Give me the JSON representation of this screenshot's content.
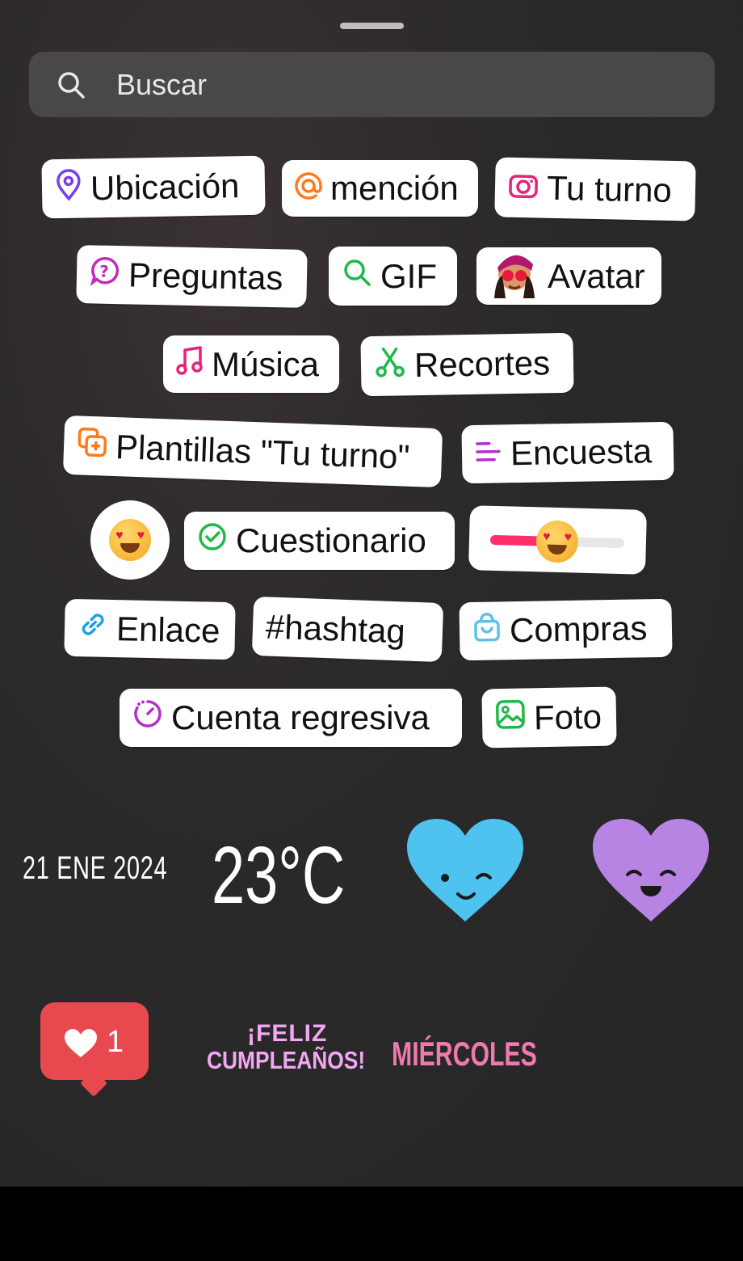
{
  "search": {
    "placeholder": "Buscar"
  },
  "stickers": {
    "ubicacion": "Ubicación",
    "mencion": "mención",
    "tu_turno": "Tu turno",
    "preguntas": "Preguntas",
    "gif": "GIF",
    "avatar": "Avatar",
    "musica": "Música",
    "recortes": "Recortes",
    "plantillas": "Plantillas \"Tu turno\"",
    "encuesta": "Encuesta",
    "cuestionario": "Cuestionario",
    "enlace": "Enlace",
    "hashtag": "#hashtag",
    "compras": "Compras",
    "cuenta_regresiva": "Cuenta regresiva",
    "foto": "Foto"
  },
  "widgets": {
    "date": "21 ENE 2024",
    "temperature": "23°C",
    "like_count": "1",
    "birthday_line1": "¡FELIZ",
    "birthday_line2": "CUMPLEAÑOS!",
    "weekday": "MIÉRCOLES",
    "emoji_slider_level": 0.5
  },
  "icons": [
    "search-icon",
    "location-pin-icon",
    "at-sign-icon",
    "camera-icon",
    "question-icon",
    "magnifier-icon",
    "avatar-icon",
    "music-note-icon",
    "scissors-icon",
    "template-icon",
    "poll-icon",
    "heart-eyes-emoji-icon",
    "check-circle-icon",
    "link-icon",
    "shopping-bag-icon",
    "countdown-icon",
    "photo-icon",
    "wink-heart-icon",
    "happy-heart-icon",
    "like-heart-icon"
  ],
  "colors": {
    "purple": "#7a3df0",
    "orange": "#ff7a1a",
    "pink": "#e4237a",
    "green": "#21b84a",
    "blue": "#1ea0e6",
    "heart_blue": "#4ec3f0",
    "heart_purple": "#b784e3",
    "like_red": "#e8494f"
  }
}
